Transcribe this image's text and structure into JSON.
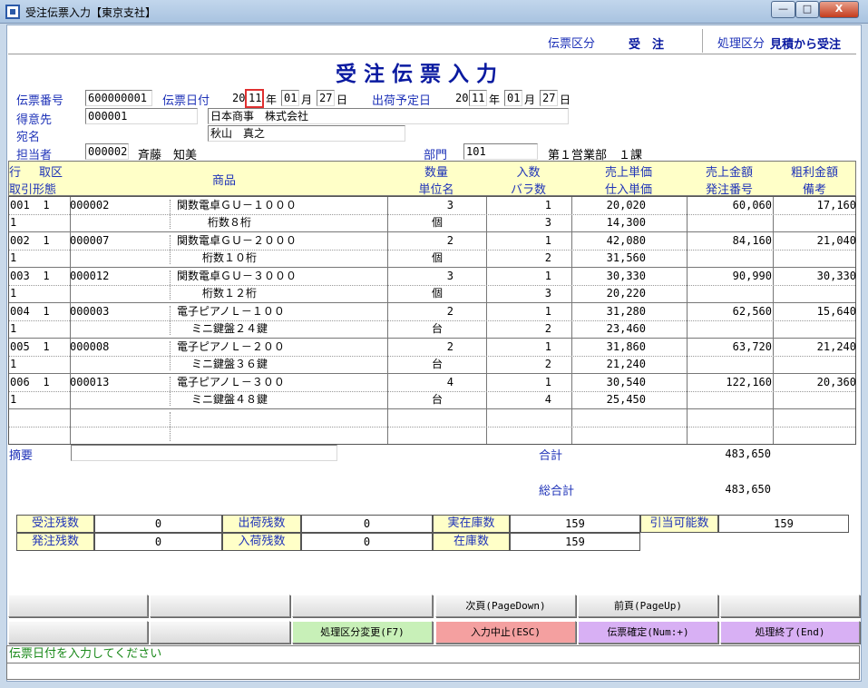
{
  "window": {
    "title": "受注伝票入力【東京支社】",
    "min": "—",
    "max": "□",
    "close": "X"
  },
  "topbar": {
    "slip_kind_label": "伝票区分",
    "slip_kind_value": "受　注",
    "process_kind_label": "処理区分",
    "process_kind_value": "見積から受注"
  },
  "heading": "受注伝票入力",
  "form": {
    "slip_no_label": "伝票番号",
    "slip_no": "600000001",
    "slip_date_label": "伝票日付",
    "slip_date": {
      "cent": "20",
      "yy": "11",
      "y": "年",
      "mm": "01",
      "m": "月",
      "dd": "27",
      "d": "日"
    },
    "ship_date_label": "出荷予定日",
    "ship_date": {
      "cent": "20",
      "yy": "11",
      "y": "年",
      "mm": "01",
      "m": "月",
      "dd": "27",
      "d": "日"
    },
    "customer_label": "得意先",
    "customer_code": "000001",
    "customer_name": "日本商事　株式会社",
    "addressee_label": "宛名",
    "addressee": "秋山　真之",
    "staff_label": "担当者",
    "staff_code": "000002",
    "staff_name": "斉藤　知美",
    "dept_label": "部門",
    "dept_code": "101",
    "dept_name": "第１営業部　１課"
  },
  "grid_headers": {
    "row": "行",
    "trade_kind": "取区",
    "trade_form": "取引形態",
    "product": "商品",
    "qty": "数量",
    "unit": "単位名",
    "in_count": "入数",
    "loose_count": "バラ数",
    "sale_price": "売上単価",
    "cost_price": "仕入単価",
    "sale_amount": "売上金額",
    "order_no": "発注番号",
    "gross_profit": "粗利金額",
    "note": "備考"
  },
  "lines": [
    {
      "row": "001",
      "kind": "1",
      "form": "1",
      "code": "000002",
      "name": "関数電卓ＧＵ－１０００",
      "spec": "桁数８桁",
      "qty": "3",
      "unit": "個",
      "in_count": "1",
      "loose": "3",
      "sale_price": "20,020",
      "cost_price": "14,300",
      "amount": "60,060",
      "gross": "17,160"
    },
    {
      "row": "002",
      "kind": "1",
      "form": "1",
      "code": "000007",
      "name": "関数電卓ＧＵ－２０００",
      "spec": "桁数１０桁",
      "qty": "2",
      "unit": "個",
      "in_count": "1",
      "loose": "2",
      "sale_price": "42,080",
      "cost_price": "31,560",
      "amount": "84,160",
      "gross": "21,040"
    },
    {
      "row": "003",
      "kind": "1",
      "form": "1",
      "code": "000012",
      "name": "関数電卓ＧＵ－３０００",
      "spec": "桁数１２桁",
      "qty": "3",
      "unit": "個",
      "in_count": "1",
      "loose": "3",
      "sale_price": "30,330",
      "cost_price": "20,220",
      "amount": "90,990",
      "gross": "30,330"
    },
    {
      "row": "004",
      "kind": "1",
      "form": "1",
      "code": "000003",
      "name": "電子ピアノＬ－１００",
      "spec": "ミニ鍵盤２４鍵",
      "qty": "2",
      "unit": "台",
      "in_count": "1",
      "loose": "2",
      "sale_price": "31,280",
      "cost_price": "23,460",
      "amount": "62,560",
      "gross": "15,640"
    },
    {
      "row": "005",
      "kind": "1",
      "form": "1",
      "code": "000008",
      "name": "電子ピアノＬ－２００",
      "spec": "ミニ鍵盤３６鍵",
      "qty": "2",
      "unit": "台",
      "in_count": "1",
      "loose": "2",
      "sale_price": "31,860",
      "cost_price": "21,240",
      "amount": "63,720",
      "gross": "21,240"
    },
    {
      "row": "006",
      "kind": "1",
      "form": "1",
      "code": "000013",
      "name": "電子ピアノＬ－３００",
      "spec": "ミニ鍵盤４８鍵",
      "qty": "4",
      "unit": "台",
      "in_count": "1",
      "loose": "4",
      "sale_price": "30,540",
      "cost_price": "25,450",
      "amount": "122,160",
      "gross": "20,360"
    }
  ],
  "summary": {
    "memo_label": "摘要",
    "memo_value": "",
    "subtotal_label": "合計",
    "subtotal": "483,650",
    "total_label": "総合計",
    "total": "483,650"
  },
  "stock": {
    "order_remain_label": "受注残数",
    "order_remain": "0",
    "ship_remain_label": "出荷残数",
    "ship_remain": "0",
    "actual_stock_label": "実在庫数",
    "actual_stock": "159",
    "allocatable_label": "引当可能数",
    "allocatable": "159",
    "po_remain_label": "発注残数",
    "po_remain": "0",
    "receive_remain_label": "入荷残数",
    "receive_remain": "0",
    "stock_label": "在庫数",
    "stock": "159"
  },
  "buttons": {
    "next_page": "次頁(PageDown)",
    "prev_page": "前頁(PageUp)",
    "change_mode": "処理区分変更(F7)",
    "cancel_input": "入力中止(ESC)",
    "confirm": "伝票確定(Num:+)",
    "exit": "処理終了(End)"
  },
  "colors": {
    "change_mode": "#c8f0b8",
    "cancel_input": "#f4a0a0",
    "confirm": "#d8b0f4",
    "exit": "#d8b0f4"
  },
  "status_message": "伝票日付を入力してください"
}
